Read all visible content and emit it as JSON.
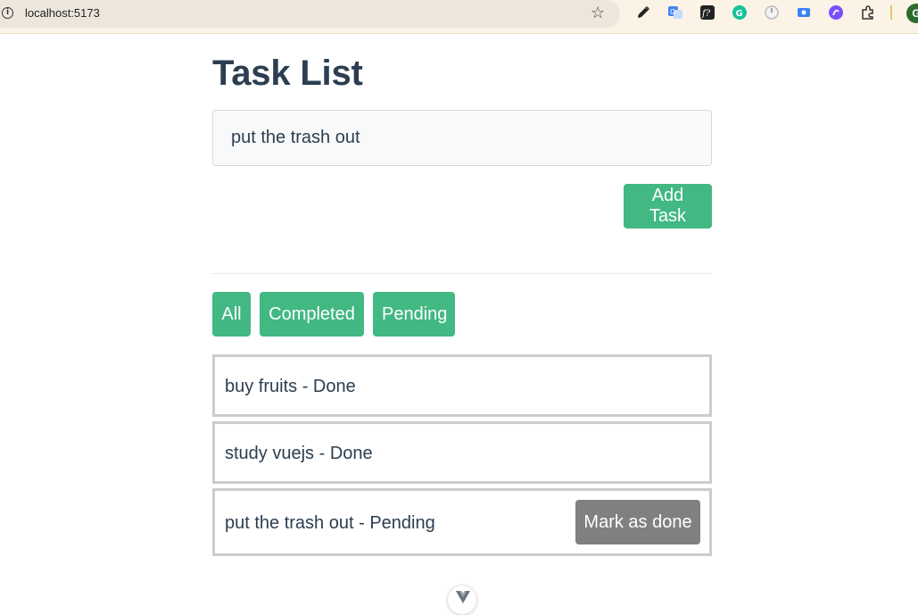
{
  "browser": {
    "url": "localhost:5173",
    "profile_initial": "G",
    "extensions": [
      "eyedropper-icon",
      "translate-icon",
      "font-icon",
      "grammarly-icon",
      "timer-icon",
      "screen-capture-icon",
      "assistant-icon",
      "puzzle-icon"
    ]
  },
  "app": {
    "title": "Task List",
    "input": {
      "value": "put the trash out"
    },
    "add_button": "Add Task",
    "filters": [
      "All",
      "Completed",
      "Pending"
    ],
    "tasks": [
      {
        "text": "buy fruits - Done",
        "status": "done"
      },
      {
        "text": "study vuejs - Done",
        "status": "done"
      },
      {
        "text": "put the trash out - Pending",
        "status": "pending",
        "action": "Mark as done"
      }
    ]
  },
  "colors": {
    "accent": "#42b883",
    "secondary_button": "#808080",
    "text": "#2c3e50",
    "task_border": "#cccccc"
  }
}
